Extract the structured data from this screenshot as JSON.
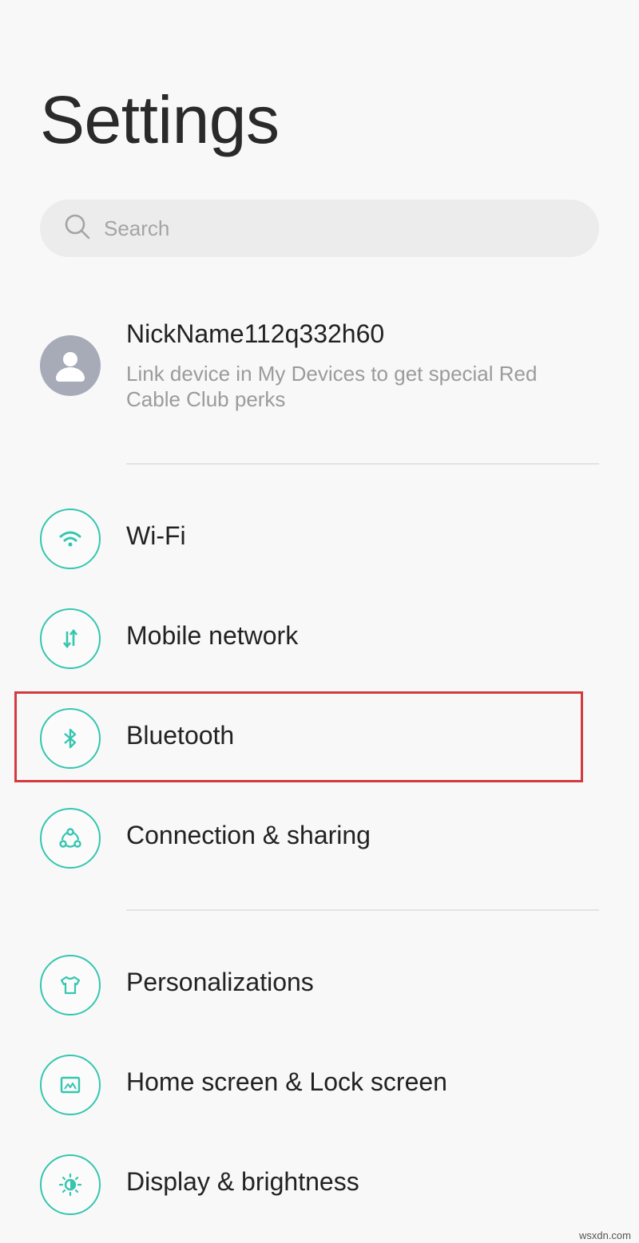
{
  "header": {
    "title": "Settings"
  },
  "search": {
    "placeholder": "Search"
  },
  "account": {
    "name": "NickName112q332h60",
    "subtitle": "Link device in My Devices to get special Red Cable Club perks"
  },
  "network_items": [
    {
      "label": "Wi-Fi",
      "icon": "wifi-icon"
    },
    {
      "label": "Mobile network",
      "icon": "mobile-data-icon"
    },
    {
      "label": "Bluetooth",
      "icon": "bluetooth-icon"
    },
    {
      "label": "Connection & sharing",
      "icon": "share-icon"
    }
  ],
  "display_items": [
    {
      "label": "Personalizations",
      "icon": "tshirt-icon"
    },
    {
      "label": "Home screen & Lock screen",
      "icon": "wallpaper-icon"
    },
    {
      "label": "Display & brightness",
      "icon": "brightness-icon"
    }
  ],
  "highlight": {
    "target": "Bluetooth",
    "color": "#d33a3f"
  },
  "colors": {
    "accent": "#35c6b0",
    "background": "#f8f8f8",
    "avatar": "#a7abb8"
  },
  "watermark": "wsxdn.com"
}
